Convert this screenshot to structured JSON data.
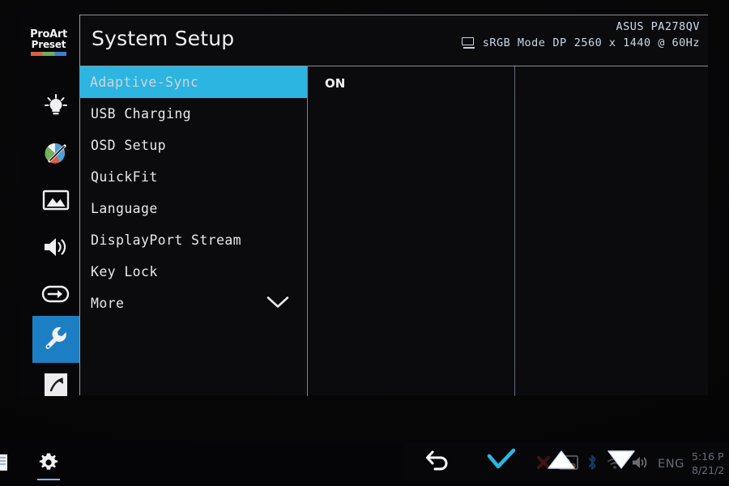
{
  "osd": {
    "brand": {
      "line1": "ProArt",
      "line2": "Preset",
      "colorbar_colors": [
        "#d7624a",
        "#6fae5a",
        "#3f7fd0"
      ]
    },
    "accent_color": "#2bb5e0",
    "rail_selected_color": "#1d7fc3",
    "rail_items": [
      {
        "name": "brightness-icon",
        "label": "Splendid / Brightness",
        "selected": false
      },
      {
        "name": "color-icon",
        "label": "Color",
        "selected": false
      },
      {
        "name": "image-icon",
        "label": "Image",
        "selected": false
      },
      {
        "name": "sound-icon",
        "label": "Sound",
        "selected": false
      },
      {
        "name": "input-select-icon",
        "label": "Input Select",
        "selected": false
      },
      {
        "name": "wrench-icon",
        "label": "System Setup",
        "selected": true
      },
      {
        "name": "shortcut-icon",
        "label": "Shortcut",
        "selected": false
      }
    ],
    "header": {
      "title": "System Setup",
      "model": "ASUS PA278QV",
      "mode": "sRGB Mode",
      "input": "DP",
      "resolution": "2560 x 1440 @ 60Hz",
      "monitor_icon": "monitor-icon"
    },
    "menu": [
      {
        "label": "Adaptive-Sync",
        "active": true,
        "chevron": false
      },
      {
        "label": "USB Charging",
        "active": false,
        "chevron": false
      },
      {
        "label": "OSD Setup",
        "active": false,
        "chevron": false
      },
      {
        "label": "QuickFit",
        "active": false,
        "chevron": false
      },
      {
        "label": "Language",
        "active": false,
        "chevron": false
      },
      {
        "label": "DisplayPort Stream",
        "active": false,
        "chevron": false
      },
      {
        "label": "Key Lock",
        "active": false,
        "chevron": false
      },
      {
        "label": "More",
        "active": false,
        "chevron": true
      }
    ],
    "value": "ON"
  },
  "osd_buttons": [
    {
      "name": "back-button",
      "icon": "back-arrow-icon",
      "color": "#ffffff"
    },
    {
      "name": "confirm-button",
      "icon": "checkmark-icon",
      "color": "#2bb5e0"
    },
    {
      "name": "up-button",
      "icon": "triangle-up-icon",
      "color": "#ffffff"
    },
    {
      "name": "down-button",
      "icon": "triangle-down-icon",
      "color": "#ffffff"
    }
  ],
  "taskbar": {
    "apps": [
      {
        "name": "window-app-icon",
        "label": "Window"
      },
      {
        "name": "settings-gear-icon",
        "label": "Settings",
        "active": true
      }
    ],
    "tray": [
      {
        "name": "tray-red-icon",
        "label": "Tray App"
      },
      {
        "name": "display-settings-icon",
        "label": "Display Settings"
      },
      {
        "name": "bluetooth-icon",
        "label": "Bluetooth"
      },
      {
        "name": "wifi-icon",
        "label": "Network"
      },
      {
        "name": "volume-icon",
        "label": "Volume"
      }
    ],
    "language": "ENG",
    "clock": {
      "time": "5:16 P",
      "date": "8/21/2"
    }
  }
}
